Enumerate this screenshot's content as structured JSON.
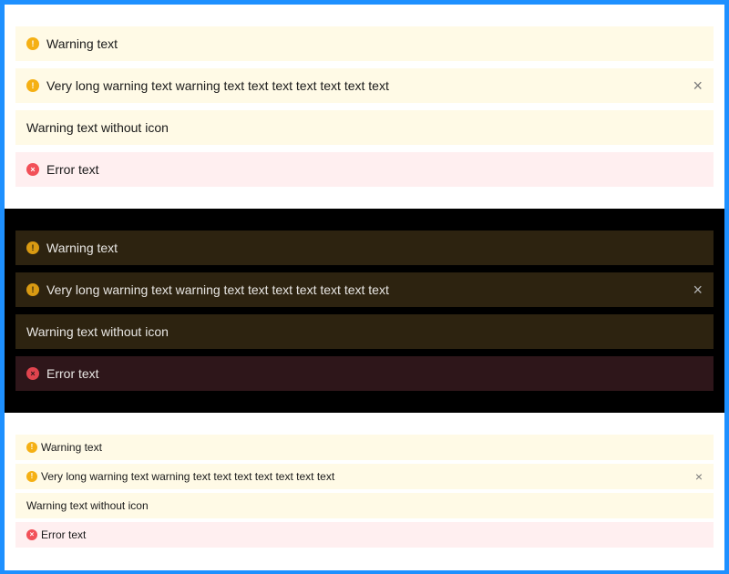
{
  "colors": {
    "frame_border": "#1e90ff",
    "warning_bg_light": "#fffae6",
    "error_bg_light": "#ffeff0",
    "warning_bg_dark": "#2d2310",
    "error_bg_dark": "#2e161a",
    "warning_icon": "#f5b014",
    "error_icon": "#f25058"
  },
  "icons": {
    "warning": "!",
    "error": "×",
    "close": "×"
  },
  "light": {
    "warning": "Warning text",
    "warning_long": "Very long warning text warning text text text text text text text",
    "warning_no_icon": "Warning text without icon",
    "error": "Error text"
  },
  "dark": {
    "warning": "Warning text",
    "warning_long": "Very long warning text warning text text text text text text text",
    "warning_no_icon": "Warning text without icon",
    "error": "Error text"
  },
  "compact": {
    "warning": "Warning text",
    "warning_long": "Very long warning text warning text text text text text text text",
    "warning_no_icon": "Warning text without icon",
    "error": "Error text"
  }
}
